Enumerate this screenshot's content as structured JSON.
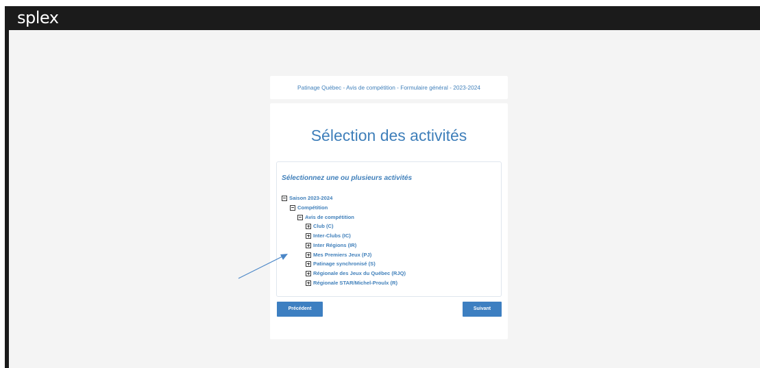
{
  "app": {
    "logo_text_main": "sple",
    "logo_text_x": "x"
  },
  "form": {
    "header_title": "Patinage Québec - Avis de compétition - Formulaire général - 2023-2024",
    "page_title": "Sélection des activités",
    "instruction": "Sélectionnez une ou plusieurs activités"
  },
  "tree": {
    "season": {
      "label": "Saison 2023-2024",
      "state": "expanded"
    },
    "category": {
      "label": "Compétition",
      "state": "expanded"
    },
    "subcategory": {
      "label": "Avis de compétition",
      "state": "expanded"
    },
    "items": [
      {
        "label": "Club (C)",
        "state": "collapsed"
      },
      {
        "label": "Inter-Clubs (IC)",
        "state": "collapsed"
      },
      {
        "label": "Inter Régions (IR)",
        "state": "collapsed"
      },
      {
        "label": "Mes Premiers Jeux (PJ)",
        "state": "collapsed"
      },
      {
        "label": "Patinage synchronisé (S)",
        "state": "collapsed"
      },
      {
        "label": "Régionale des Jeux du Québec (RJQ)",
        "state": "collapsed"
      },
      {
        "label": "Régionale STAR/Michel-Proulx (R)",
        "state": "collapsed"
      }
    ]
  },
  "buttons": {
    "previous": "Précédent",
    "next": "Suivant"
  },
  "colors": {
    "accent": "#3f7fba",
    "button": "#3d7fc1",
    "topbar": "#1b1b1b",
    "background": "#f4f4f4",
    "annotation_arrow": "#4a86c7"
  }
}
